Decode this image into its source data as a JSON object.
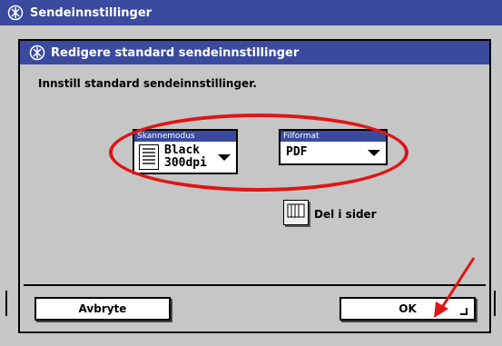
{
  "window": {
    "title": "Sendeinnstillinger"
  },
  "dialog": {
    "title": "Redigere standard sendeinnstillinger",
    "instruction": "Innstill standard sendeinnstillinger."
  },
  "scan_mode": {
    "label": "Skannemodus",
    "value_line1": "Black",
    "value_line2": "300dpi"
  },
  "file_format": {
    "label": "Filformat",
    "value": "PDF"
  },
  "split_pages": {
    "label": "Del i sider"
  },
  "buttons": {
    "cancel": "Avbryte",
    "ok": "OK"
  },
  "colors": {
    "title_bar": "#3a4a9e",
    "background": "#c6c6c6",
    "annotation_red": "#e01515"
  },
  "icons": [
    "settings-icon",
    "doc-scan-icon",
    "split-pages-icon",
    "dropdown-arrow-icon",
    "enter-icon"
  ]
}
